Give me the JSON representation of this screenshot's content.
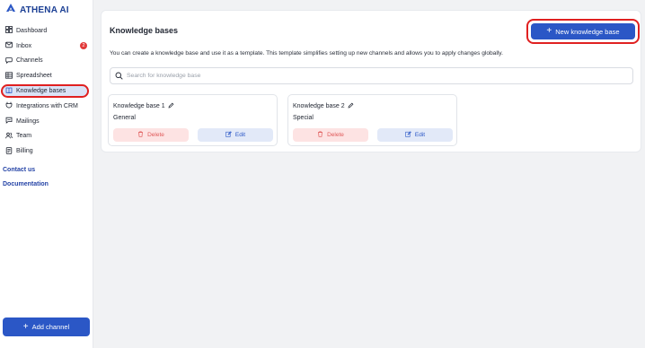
{
  "app": {
    "logo_text": "ATHENA AI"
  },
  "sidebar": {
    "items": [
      {
        "label": "Dashboard",
        "icon": "dashboard-icon"
      },
      {
        "label": "Inbox",
        "icon": "inbox-icon",
        "badge": "2"
      },
      {
        "label": "Channels",
        "icon": "channels-icon"
      },
      {
        "label": "Spreadsheet",
        "icon": "spreadsheet-icon"
      },
      {
        "label": "Knowledge bases",
        "icon": "knowledge-base-icon",
        "active": true
      },
      {
        "label": "Integrations with CRM",
        "icon": "integrations-icon"
      },
      {
        "label": "Mailings",
        "icon": "mailings-icon"
      },
      {
        "label": "Team",
        "icon": "team-icon"
      },
      {
        "label": "Billing",
        "icon": "billing-icon"
      }
    ],
    "contact_label": "Contact us",
    "docs_label": "Documentation",
    "add_channel_label": "Add channel"
  },
  "main": {
    "title": "Knowledge bases",
    "new_button_label": "New knowledge base",
    "description": "You can create a knowledge base and use it as a template. This template simplifies setting up new channels and allows you to apply changes globally.",
    "search_placeholder": "Search for knowledge base",
    "knowledge_bases": [
      {
        "name": "Knowledge base 1",
        "type": "General",
        "delete_label": "Delete",
        "edit_label": "Edit"
      },
      {
        "name": "Knowledge base 2",
        "type": "Special",
        "delete_label": "Delete",
        "edit_label": "Edit"
      }
    ]
  },
  "colors": {
    "primary": "#2b57c6",
    "highlight_outline": "#e02020",
    "delete_bg": "#fde3e3",
    "delete_text": "#e05a5a",
    "edit_bg": "#e2e9f8"
  }
}
